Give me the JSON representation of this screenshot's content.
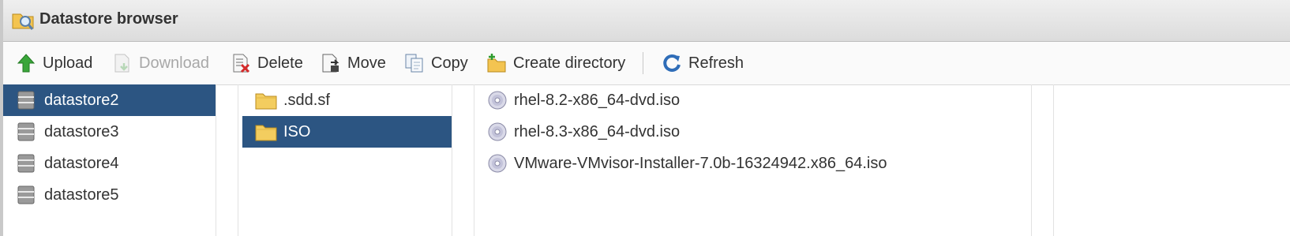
{
  "window": {
    "title": "Datastore browser"
  },
  "toolbar": {
    "upload": "Upload",
    "download": "Download",
    "delete": "Delete",
    "move": "Move",
    "copy": "Copy",
    "create_directory": "Create directory",
    "refresh": "Refresh"
  },
  "datastores": [
    {
      "label": "datastore2",
      "selected": true
    },
    {
      "label": "datastore3",
      "selected": false
    },
    {
      "label": "datastore4",
      "selected": false
    },
    {
      "label": "datastore5",
      "selected": false
    }
  ],
  "folders": [
    {
      "label": ".sdd.sf",
      "selected": false
    },
    {
      "label": "ISO",
      "selected": true
    }
  ],
  "files": [
    {
      "label": "rhel-8.2-x86_64-dvd.iso"
    },
    {
      "label": "rhel-8.3-x86_64-dvd.iso"
    },
    {
      "label": "VMware-VMvisor-Installer-7.0b-16324942.x86_64.iso"
    }
  ],
  "colors": {
    "selection": "#2c5582",
    "disabled_text": "#a8a8a8"
  }
}
